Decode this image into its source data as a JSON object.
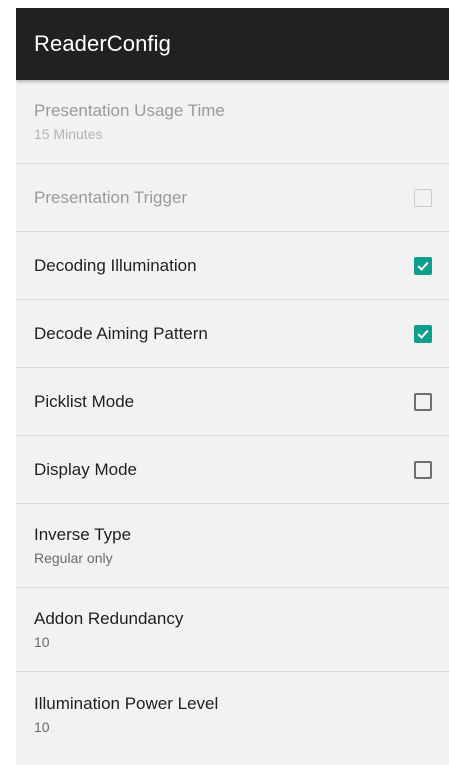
{
  "appbar": {
    "title": "ReaderConfig"
  },
  "settings": [
    {
      "title": "Presentation Usage Time",
      "summary": "15 Minutes",
      "enabled": false
    },
    {
      "title": "Presentation Trigger",
      "checkbox": "unchecked",
      "enabled": false
    },
    {
      "title": "Decoding Illumination",
      "checkbox": "checked",
      "enabled": true
    },
    {
      "title": "Decode Aiming Pattern",
      "checkbox": "checked",
      "enabled": true
    },
    {
      "title": "Picklist Mode",
      "checkbox": "unchecked",
      "enabled": true
    },
    {
      "title": "Display Mode",
      "checkbox": "unchecked",
      "enabled": true
    },
    {
      "title": "Inverse Type",
      "summary": "Regular only",
      "enabled": true
    },
    {
      "title": "Addon Redundancy",
      "summary": "10",
      "enabled": true
    },
    {
      "title": "Illumination Power Level",
      "summary": "10",
      "enabled": true
    }
  ],
  "colors": {
    "appbar_bg": "#212121",
    "accent": "#0e9e8c",
    "background": "#f2f2f2"
  }
}
